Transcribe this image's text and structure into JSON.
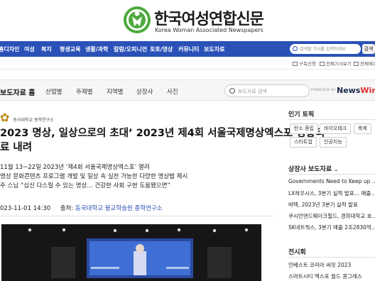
{
  "site": {
    "title": "한국여성연합신문",
    "subtitle": "Korea Woman Associated Newspapers"
  },
  "nav": {
    "items": [
      "홈디자인",
      "여성",
      "복지",
      "평생교육",
      "생활/과학",
      "칼럼/오피니언",
      "포토/영상",
      "커뮤니티",
      "보도자료"
    ],
    "search_placeholder": "검색할 기사를 입력하세요",
    "search_button": "검색"
  },
  "utility": {
    "items": [
      "구독신청",
      "전체기사보기",
      "전체메뉴"
    ]
  },
  "newswire": {
    "home_label": "보도자료 홈",
    "tabs": [
      "산업별",
      "주제별",
      "지역별",
      "상장사",
      "사진"
    ],
    "search_placeholder": "보도자료 검색",
    "powered_by": "POWERED BY",
    "logo_text": "News",
    "logo_accent": "Wire"
  },
  "article": {
    "source_logo": "동국대학교 종학연구소",
    "headline_lines": [
      "2023 명상, 일상으로의 초대’ 2023년 제4회 서울국제명상엑스포 성황리",
      "료 내려"
    ],
    "summary_lines": [
      "11월 13~22일 2023년 ‘제4회 서울국제명상엑스포’ 열려",
      "명상 문화콘텐츠 프로그램 개발 및 일상 속 실천 가능한 다양한 명상법 제시",
      "주 스님 “심신 다스릴 수 있는 명상… 건강한 사회 구현 도움됐으면”"
    ],
    "datetime": "023-11-01 14:30",
    "source_label": "출처:",
    "source_name": "동국대학교 불교학술원 종학연구소"
  },
  "sidebar": {
    "popular_title": "인기 토픽",
    "popular_tags": [
      "탄소 중립",
      "바이오테크",
      "축제",
      "스타트업",
      "인공지능"
    ],
    "company_title": "상장사 보도자료",
    "company_items": [
      "Governments Need to Keep up ...",
      "LX하우시스, 3분기 실적 발표… 매출...",
      "바텍, 2023년 3분기 실적 발표",
      "쿠시먼앤드웨이크필드, 경희대학교 호...",
      "SK네트웍스, 3분기 매출 2조2830억..."
    ],
    "exhibit_title": "전시회",
    "exhibit_items": [
      "인베스트 코리아 써밋 2023",
      "스마트시티 엑스포 월드 콩그레스"
    ]
  },
  "colors": {
    "nav_blue": "#2a51b8",
    "logo_green": "#4caa3c",
    "link_blue": "#2a51b8",
    "accent_red": "#e03030"
  }
}
